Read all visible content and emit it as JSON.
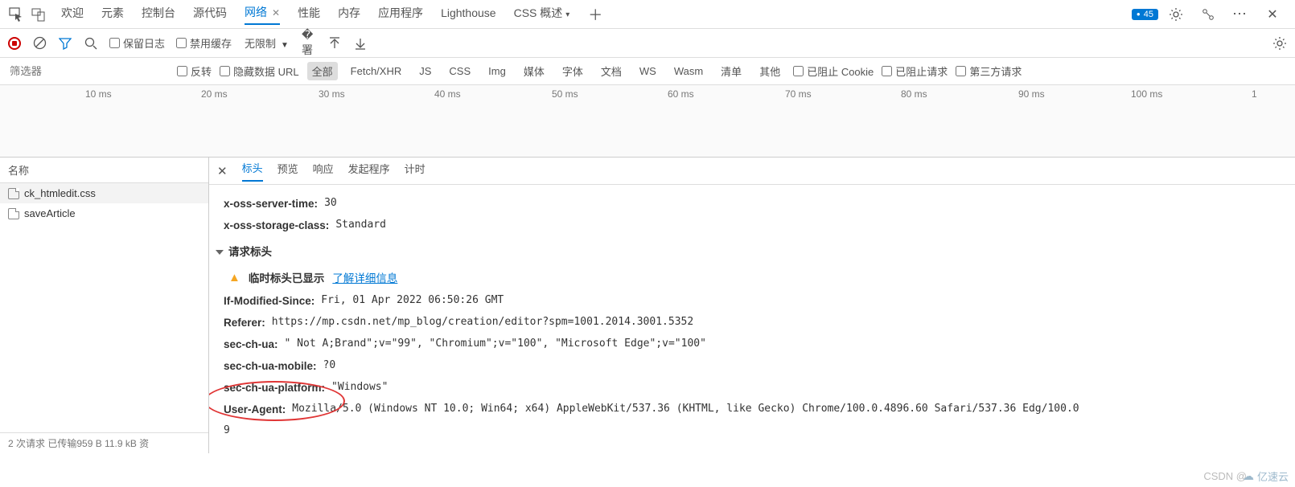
{
  "topbar": {
    "tabs": [
      "欢迎",
      "元素",
      "控制台",
      "源代码",
      "网络",
      "性能",
      "内存",
      "应用程序",
      "Lighthouse",
      "CSS 概述"
    ],
    "active_index": 4,
    "badge_count": "45"
  },
  "toolbar": {
    "preserve_log": "保留日志",
    "disable_cache": "禁用缓存",
    "throttling": "无限制"
  },
  "filterbar": {
    "placeholder": "筛选器",
    "invert": "反转",
    "hide_data_urls": "隐藏数据 URL",
    "chips": [
      "全部",
      "Fetch/XHR",
      "JS",
      "CSS",
      "Img",
      "媒体",
      "字体",
      "文档",
      "WS",
      "Wasm",
      "清单",
      "其他"
    ],
    "active_chip": 0,
    "blocked_cookies": "已阻止 Cookie",
    "blocked_requests": "已阻止请求",
    "third_party": "第三方请求"
  },
  "timeline": {
    "ticks": [
      "10 ms",
      "20 ms",
      "30 ms",
      "40 ms",
      "50 ms",
      "60 ms",
      "70 ms",
      "80 ms",
      "90 ms",
      "100 ms",
      "1"
    ]
  },
  "sidebar": {
    "name_header": "名称",
    "items": [
      "ck_htmledit.css",
      "saveArticle"
    ],
    "selected": 0,
    "status": "2 次请求  已传输959 B  11.9 kB 资"
  },
  "content": {
    "tabs": [
      "标头",
      "预览",
      "响应",
      "发起程序",
      "计时"
    ],
    "active_index": 0,
    "response_headers": {
      "x-oss-server-time": "30",
      "x-oss-storage-class": "Standard"
    },
    "section_title": "请求标头",
    "warn_text": "临时标头已显示",
    "learn_more": "了解详细信息",
    "request_headers": {
      "If-Modified-Since": "Fri, 01 Apr 2022 06:50:26 GMT",
      "Referer": "https://mp.csdn.net/mp_blog/creation/editor?spm=1001.2014.3001.5352",
      "sec-ch-ua": "\" Not A;Brand\";v=\"99\", \"Chromium\";v=\"100\", \"Microsoft Edge\";v=\"100\"",
      "sec-ch-ua-mobile": "?0",
      "sec-ch-ua-platform": "\"Windows\"",
      "User-Agent": "Mozilla/5.0 (Windows NT 10.0; Win64; x64) AppleWebKit/537.36 (KHTML, like Gecko) Chrome/100.0.4896.60 Safari/537.36 Edg/100.0",
      "User-Agent-cont": "9"
    }
  },
  "watermark": {
    "csdn": "CSDN @",
    "yisuyun": "亿速云"
  }
}
